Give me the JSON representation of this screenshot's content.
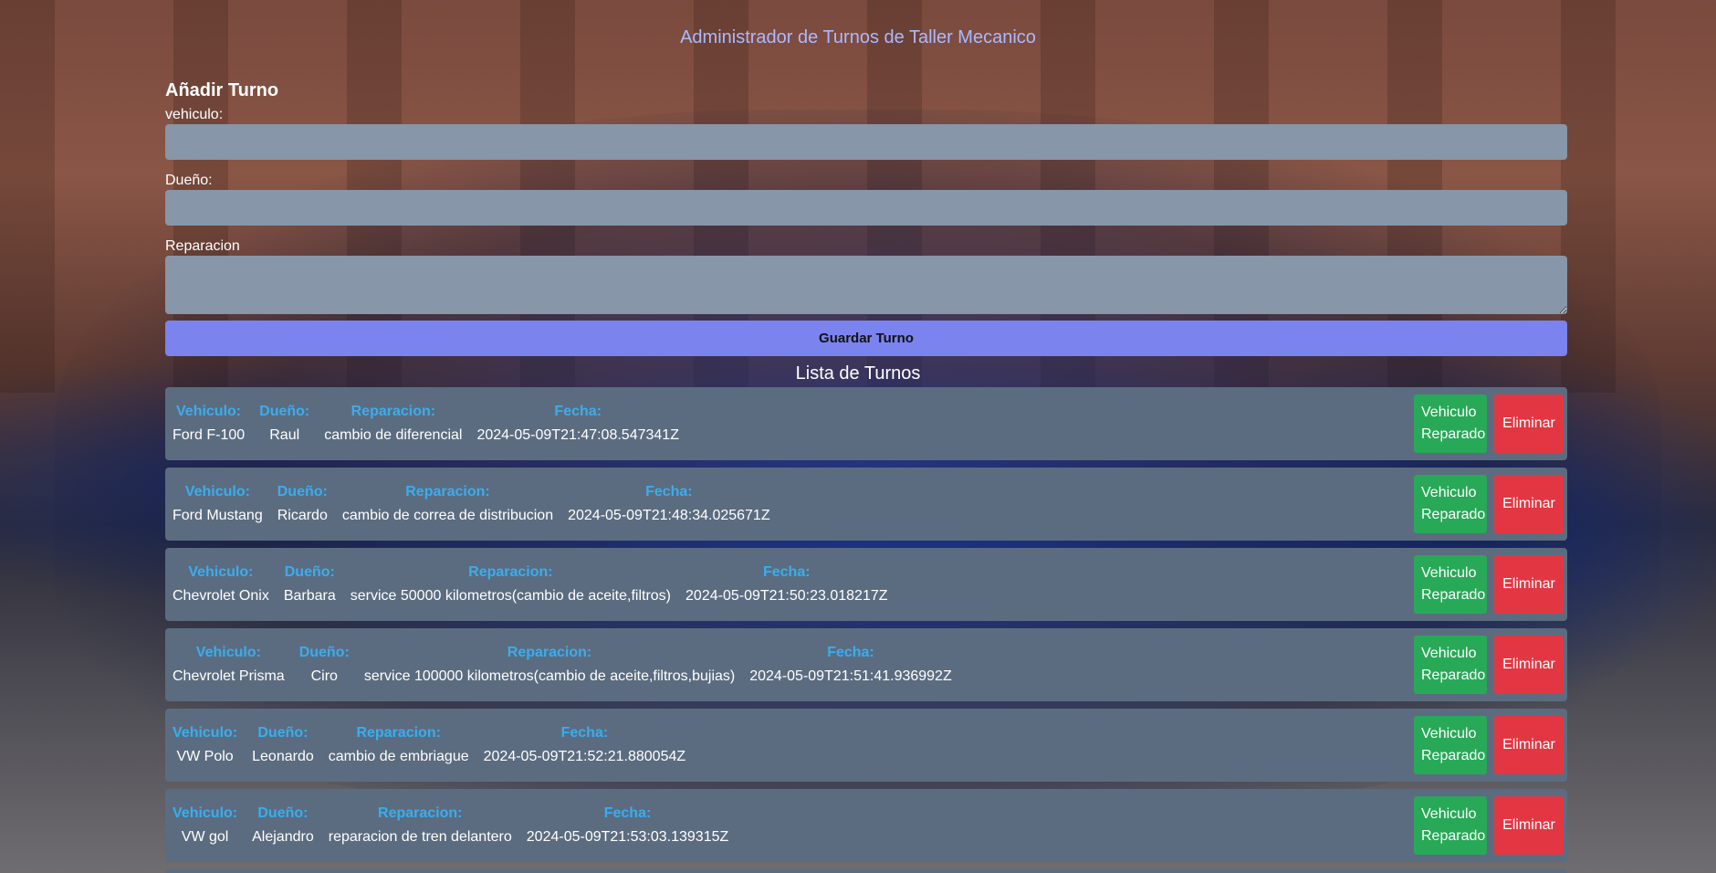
{
  "app_title": "Administrador de Turnos de Taller Mecanico",
  "form": {
    "heading": "Añadir Turno",
    "vehiculo_label": "vehiculo:",
    "vehiculo_value": "",
    "dueno_label": "Dueño:",
    "dueno_value": "",
    "reparacion_label": "Reparacion",
    "reparacion_value": "",
    "save_label": "Guardar Turno"
  },
  "list_title": "Lista de Turnos",
  "column_labels": {
    "vehiculo": "Vehiculo:",
    "dueno": "Dueño:",
    "reparacion": "Reparacion:",
    "fecha": "Fecha:"
  },
  "actions": {
    "repaired_label": "Vehiculo Reparado",
    "delete_label": "Eliminar"
  },
  "turnos": [
    {
      "vehiculo": "Ford F-100",
      "dueno": "Raul",
      "reparacion": "cambio de diferencial",
      "fecha": "2024-05-09T21:47:08.547341Z"
    },
    {
      "vehiculo": "Ford Mustang",
      "dueno": "Ricardo",
      "reparacion": "cambio de correa de distribucion",
      "fecha": "2024-05-09T21:48:34.025671Z"
    },
    {
      "vehiculo": "Chevrolet Onix",
      "dueno": "Barbara",
      "reparacion": "service 50000 kilometros(cambio de aceite,filtros)",
      "fecha": "2024-05-09T21:50:23.018217Z"
    },
    {
      "vehiculo": "Chevrolet Prisma",
      "dueno": "Ciro",
      "reparacion": "service 100000 kilometros(cambio de aceite,filtros,bujias)",
      "fecha": "2024-05-09T21:51:41.936992Z"
    },
    {
      "vehiculo": "VW Polo",
      "dueno": "Leonardo",
      "reparacion": "cambio de embriague",
      "fecha": "2024-05-09T21:52:21.880054Z"
    },
    {
      "vehiculo": "VW gol",
      "dueno": "Alejandro",
      "reparacion": "reparacion de tren delantero",
      "fecha": "2024-05-09T21:53:03.139315Z"
    }
  ],
  "colors": {
    "label_blue": "#37aef0",
    "card_bg": "#5c6c80",
    "input_bg": "#8796a8",
    "save_button": "#7a83ee",
    "repaired_button": "#27a957",
    "delete_button": "#e23742"
  }
}
